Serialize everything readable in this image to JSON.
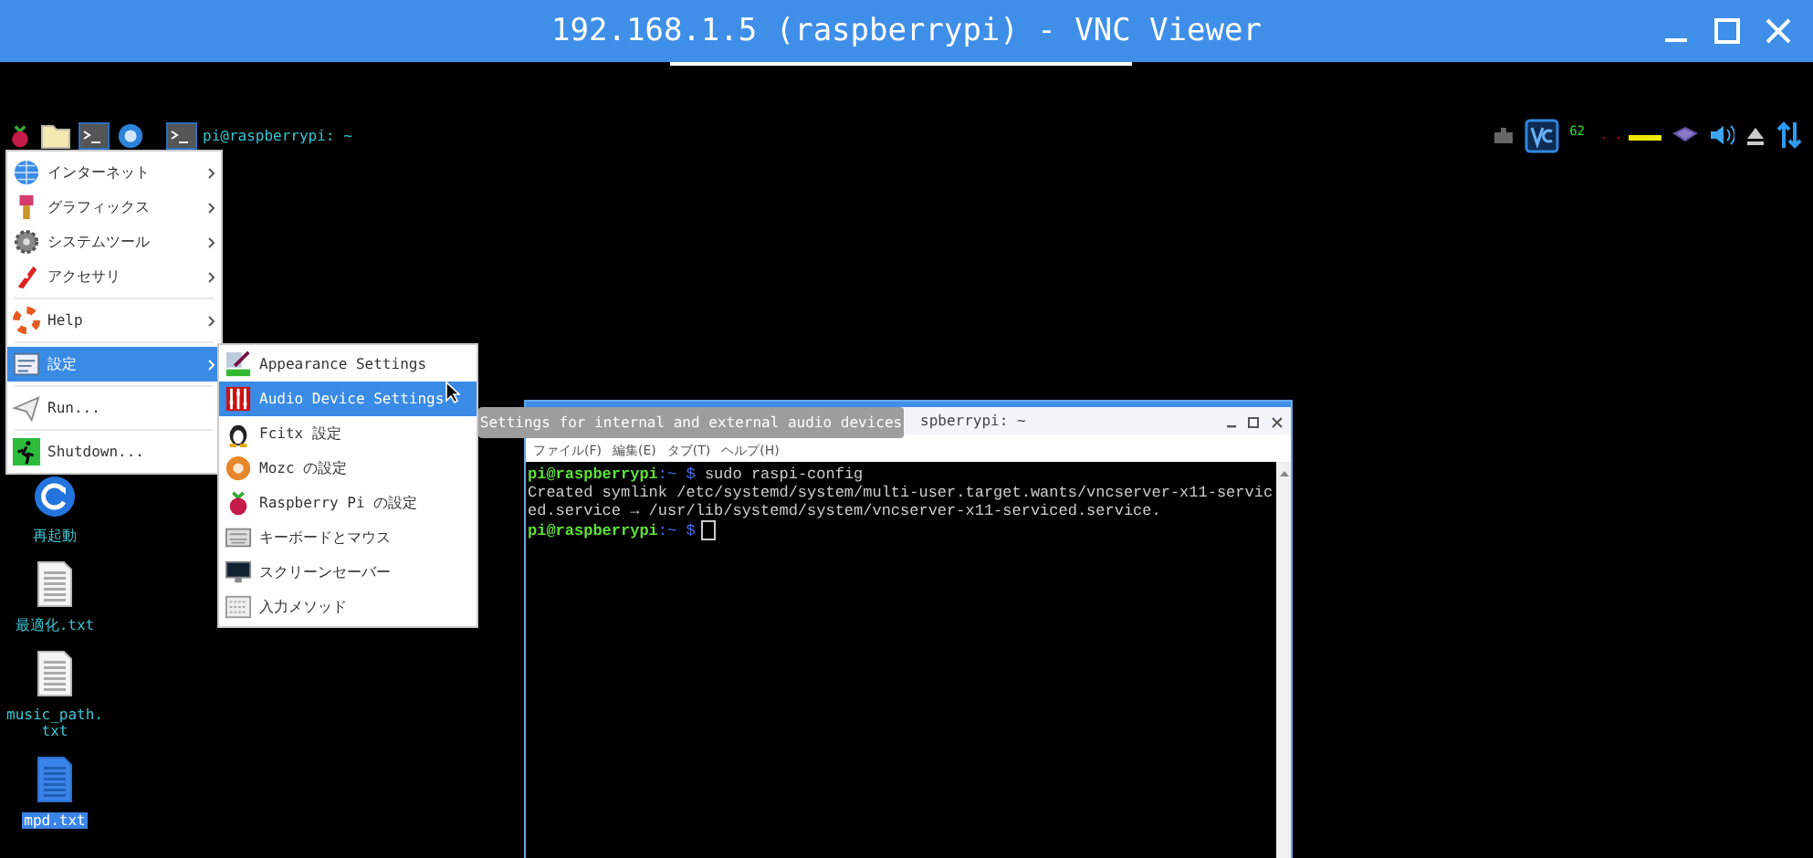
{
  "window": {
    "title": "192.168.1.5 (raspberrypi) - VNC Viewer"
  },
  "taskbar": {
    "task": {
      "label": "pi@raspberrypi: ~"
    },
    "tray": {
      "cpu_reading": "62"
    }
  },
  "menu": {
    "groups": [
      [
        {
          "label": "インターネット",
          "has_submenu": true,
          "selected": false
        },
        {
          "label": "グラフィックス",
          "has_submenu": true,
          "selected": false
        },
        {
          "label": "システムツール",
          "has_submenu": true,
          "selected": false
        },
        {
          "label": "アクセサリ",
          "has_submenu": true,
          "selected": false
        }
      ],
      [
        {
          "label": "Help",
          "has_submenu": true,
          "selected": false
        }
      ],
      [
        {
          "label": "設定",
          "has_submenu": true,
          "selected": true
        }
      ],
      [
        {
          "label": "Run...",
          "has_submenu": false,
          "selected": false
        }
      ],
      [
        {
          "label": "Shutdown...",
          "has_submenu": false,
          "selected": false
        }
      ]
    ]
  },
  "submenu": {
    "items": [
      {
        "label": "Appearance Settings",
        "selected": false
      },
      {
        "label": "Audio Device Settings",
        "selected": true
      },
      {
        "label": "Fcitx 設定",
        "selected": false
      },
      {
        "label": "Mozc の設定",
        "selected": false
      },
      {
        "label": "Raspberry Pi の設定",
        "selected": false
      },
      {
        "label": "キーボードとマウス",
        "selected": false
      },
      {
        "label": "スクリーンセーバー",
        "selected": false
      },
      {
        "label": "入力メソッド",
        "selected": false
      }
    ]
  },
  "tooltip": {
    "text": "Settings for internal and external audio devices"
  },
  "desktop_icons": [
    {
      "label": "再起動",
      "kind": "restart",
      "selected": false
    },
    {
      "label": "最適化.txt",
      "kind": "text",
      "selected": false
    },
    {
      "label": "music_path.\ntxt",
      "kind": "text",
      "selected": false
    },
    {
      "label": "mpd.txt",
      "kind": "text",
      "selected": true
    }
  ],
  "terminal": {
    "title": "spberrypi: ~",
    "menus": [
      "ファイル(F)",
      "編集(E)",
      "タブ(T)",
      "ヘルプ(H)"
    ],
    "lines": [
      {
        "kind": "prompt",
        "user": "pi@raspberrypi",
        "path": ":~ $",
        "command": "sudo raspi-config"
      },
      {
        "kind": "output",
        "text": "Created symlink /etc/systemd/system/multi-user.target.wants/vncserver-x11-servic"
      },
      {
        "kind": "output",
        "text": "ed.service → /usr/lib/systemd/system/vncserver-x11-serviced.service."
      },
      {
        "kind": "prompt",
        "user": "pi@raspberrypi",
        "path": ":~ $",
        "cursor": true
      }
    ]
  }
}
